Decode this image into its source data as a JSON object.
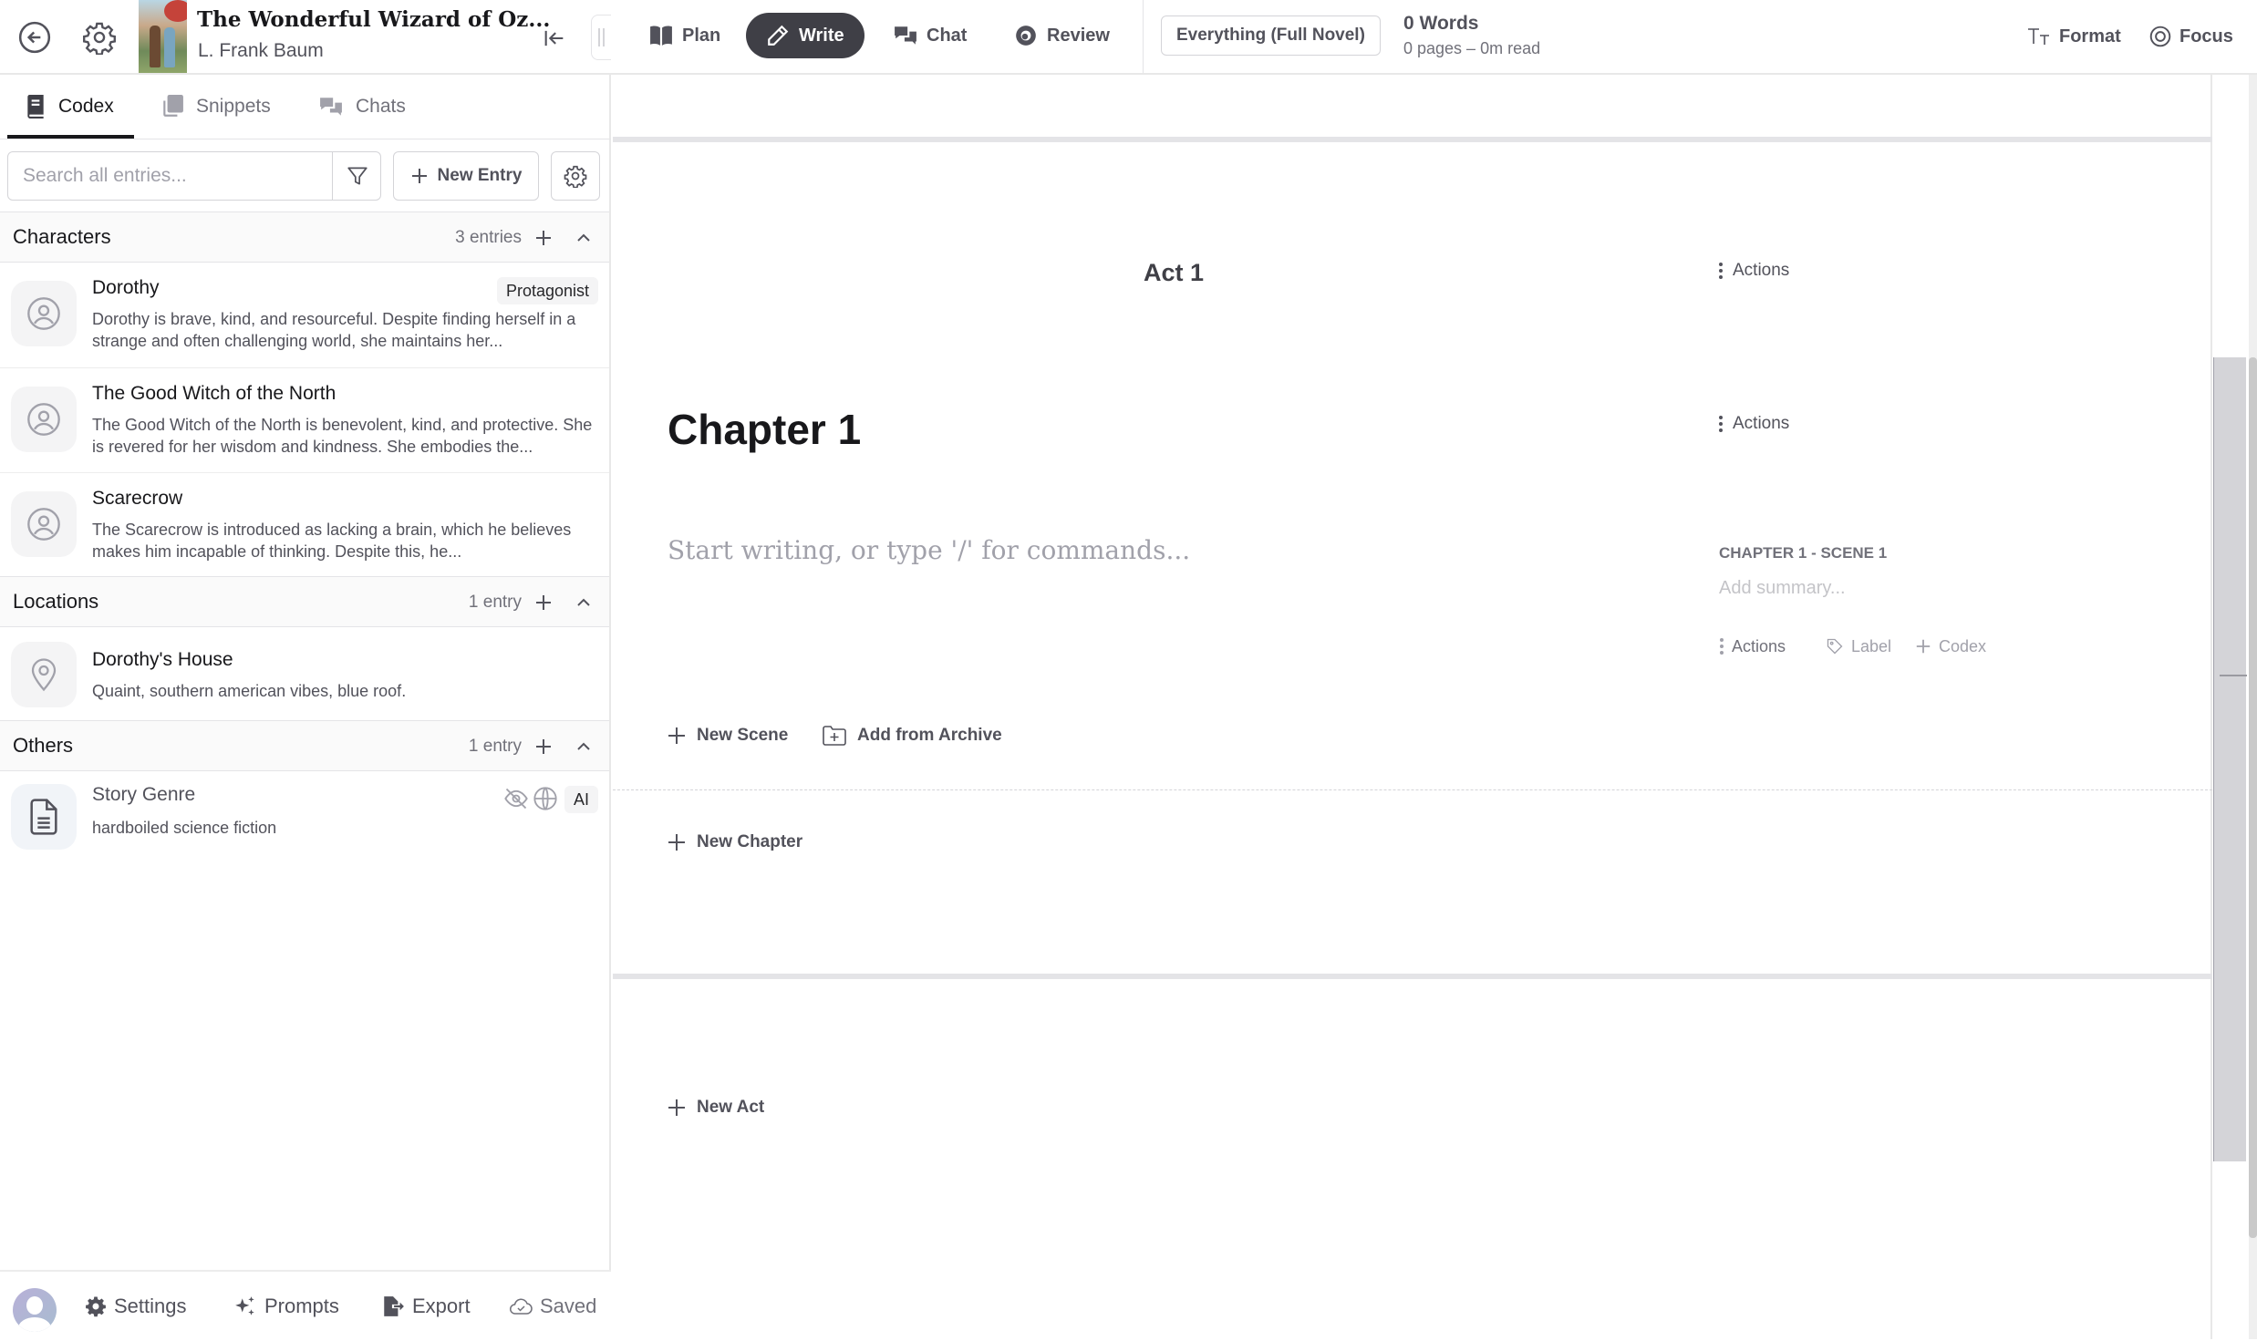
{
  "header": {
    "back_icon": "arrow-left-circle-icon",
    "settings_icon": "gear-icon",
    "book_title": "The Wonderful Wizard of Oz...",
    "book_author": "L. Frank Baum",
    "collapse_icon": "collapse-left-icon",
    "mode_tabs": [
      {
        "label": "Plan",
        "icon": "book-open-icon",
        "active": false
      },
      {
        "label": "Write",
        "icon": "pencil-icon",
        "active": true
      },
      {
        "label": "Chat",
        "icon": "chat-bubbles-icon",
        "active": false
      },
      {
        "label": "Review",
        "icon": "eye-icon",
        "active": false
      }
    ],
    "scope_select": "Everything (Full Novel)",
    "word_count": "0 Words",
    "pages_read": "0 pages  –  0m read",
    "format_label": "Format",
    "focus_label": "Focus"
  },
  "sidebar": {
    "tabs": [
      {
        "label": "Codex",
        "icon": "book-icon",
        "active": true
      },
      {
        "label": "Snippets",
        "icon": "copy-icon",
        "active": false
      },
      {
        "label": "Chats",
        "icon": "chat-bubbles-icon",
        "active": false
      }
    ],
    "search_placeholder": "Search all entries...",
    "search_value": "",
    "new_entry_label": "New Entry",
    "groups": [
      {
        "title": "Characters",
        "count": "3 entries",
        "entries": [
          {
            "name": "Dorothy",
            "badge": "Protagonist",
            "icon": "user-circle-icon",
            "desc": "Dorothy is brave, kind, and resourceful. Despite finding herself in a strange and often challenging world, she maintains her..."
          },
          {
            "name": "The Good Witch of the North",
            "icon": "user-circle-icon",
            "desc": "The Good Witch of the North is benevolent, kind, and protective. She is revered for her wisdom and kindness. She embodies the..."
          },
          {
            "name": "Scarecrow",
            "icon": "user-circle-icon",
            "desc": "The Scarecrow is introduced as lacking a brain, which he believes makes him incapable of thinking. Despite this, he..."
          }
        ]
      },
      {
        "title": "Locations",
        "count": "1 entry",
        "entries": [
          {
            "name": "Dorothy's House",
            "icon": "map-pin-icon",
            "desc": "Quaint, southern american vibes, blue roof."
          }
        ]
      },
      {
        "title": "Others",
        "count": "1 entry",
        "entries": [
          {
            "name": "Story Genre",
            "icon": "document-icon",
            "desc": "hardboiled science fiction",
            "badge": "AI"
          }
        ]
      }
    ],
    "footer": {
      "settings_label": "Settings",
      "prompts_label": "Prompts",
      "export_label": "Export",
      "saved_label": "Saved"
    }
  },
  "manuscript": {
    "act_title": "Act 1",
    "actions_label": "Actions",
    "chapter_title": "Chapter 1",
    "scene_placeholder": "Start writing, or type '/' for commands...",
    "scene_label": "CHAPTER 1 - SCENE 1",
    "summary_placeholder": "Add summary...",
    "label_label": "Label",
    "codex_label": "Codex",
    "new_scene_label": "New Scene",
    "add_from_archive_label": "Add from Archive",
    "new_chapter_label": "New Chapter",
    "new_act_label": "New Act"
  }
}
